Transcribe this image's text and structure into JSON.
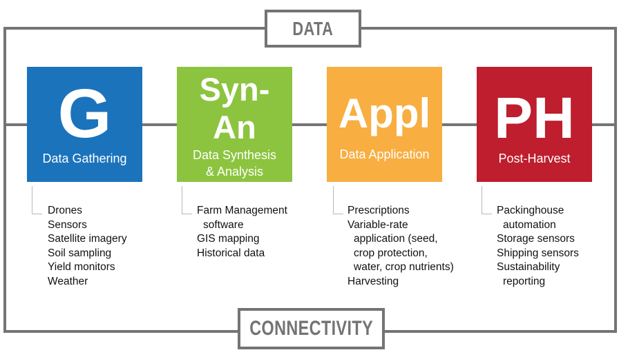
{
  "diagram": {
    "top_label": "DATA",
    "bottom_label": "CONNECTIVITY",
    "colors": {
      "frame": "#747474",
      "gathering": "#1b73bc",
      "synthesis": "#8cc43f",
      "application": "#f8ae41",
      "post_harvest": "#be1e2d"
    },
    "stages": [
      {
        "abbr": "G",
        "name": "Data Gathering",
        "items": [
          {
            "text": "Drones",
            "indent": false
          },
          {
            "text": "Sensors",
            "indent": false
          },
          {
            "text": "Satellite imagery",
            "indent": false
          },
          {
            "text": "Soil sampling",
            "indent": false
          },
          {
            "text": "Yield monitors",
            "indent": false
          },
          {
            "text": "Weather",
            "indent": false
          }
        ]
      },
      {
        "abbr_line1": "Syn-",
        "abbr_line2": "An",
        "name_line1": "Data Synthesis",
        "name_line2": "& Analysis",
        "items": [
          {
            "text": "Farm Management",
            "indent": false
          },
          {
            "text": "software",
            "indent": true
          },
          {
            "text": "GIS mapping",
            "indent": false
          },
          {
            "text": "Historical data",
            "indent": false
          }
        ]
      },
      {
        "abbr": "Appl",
        "name": "Data Application",
        "items": [
          {
            "text": "Prescriptions",
            "indent": false
          },
          {
            "text": "Variable-rate",
            "indent": false
          },
          {
            "text": "application (seed,",
            "indent": true
          },
          {
            "text": "crop protection,",
            "indent": true
          },
          {
            "text": "water, crop nutrients)",
            "indent": true
          },
          {
            "text": "Harvesting",
            "indent": false
          }
        ]
      },
      {
        "abbr": "PH",
        "name": "Post-Harvest",
        "items": [
          {
            "text": "Packinghouse",
            "indent": false
          },
          {
            "text": "automation",
            "indent": true
          },
          {
            "text": "Storage sensors",
            "indent": false
          },
          {
            "text": "Shipping sensors",
            "indent": false
          },
          {
            "text": "Sustainability",
            "indent": false
          },
          {
            "text": "reporting",
            "indent": true
          }
        ]
      }
    ]
  }
}
